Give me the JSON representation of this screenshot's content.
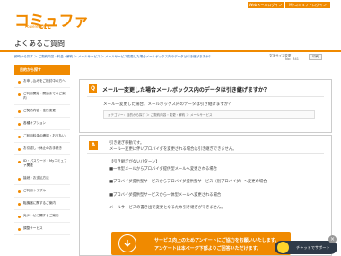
{
  "header": {
    "logo_text": "コミュファ",
    "logo_sub": "Powered by",
    "logo_brand": "ctc",
    "btn_web": "Webメールログイン",
    "btn_my": "Myコミュファログイン"
  },
  "page_title": "よくあるご質問",
  "breadcrumb": "即時から探す ＞ ご契約内容・料金・解約 ＞ メールサービス ＞ メールサービス変更した場合メールボックス内のデータは引き継げますか？",
  "toolbar": {
    "font_size_label": "文字サイズ変更",
    "print_label": "印刷"
  },
  "page_no": "No：341",
  "sidebar": {
    "heading": "目的から探す",
    "items": [
      "お申し込みをご検討中の方へ",
      "ご利用開始・開通までのご案内",
      "ご契約内容・住所変更",
      "各種オプション",
      "ご利用料金の確認・お支払い",
      "お引越し・休止のお手続き",
      "ID・パスワード・Myコミュファ関連",
      "接続・お支払方法",
      "ご利用トラブル",
      "転機器に関するご案内",
      "光テレビに関するご案内",
      "調整サービス"
    ]
  },
  "question": {
    "icon": "Q",
    "title": "メール一変更した場合メールボックス内のデータは引き継げますか？",
    "text": "メール一変更した場合、メールボックス内のデータは引き継げますか？",
    "category": "カテゴリー：目的から探す ＞ ご契約内容・変更・解約 ＞ メールサービス"
  },
  "answer": {
    "icon": "A",
    "lines": [
      "引き継ぎ移動です。",
      "メール一変更に伴いプロバイダを変更される場合は引き継ぎできません。",
      "",
      "【引き継ぎがないパターン】",
      "■一体型メールからプロバイダ提供型メールへ変更される場合",
      "",
      "■プロバイダ提供型サービスからプロバイダ提供型サービス（別プロバイダ）へ変更の場合",
      "",
      "■プロバイダ提供型サービスから一体型メールへ変更される場合",
      "",
      "メールサービスの書き出で変更となるため引き継ぎができません。"
    ],
    "banner_line1": "サービス向上のためアンケートにご協力をお願いいたします。",
    "banner_line2": "アンケートは本ページ下部よりご回答いただけます。"
  },
  "chat": {
    "label": "チャットでサポート",
    "close": "×"
  },
  "colors": {
    "brand": "#f08a00",
    "link": "#1a5aa6",
    "chat_bg": "#2f3a48"
  }
}
